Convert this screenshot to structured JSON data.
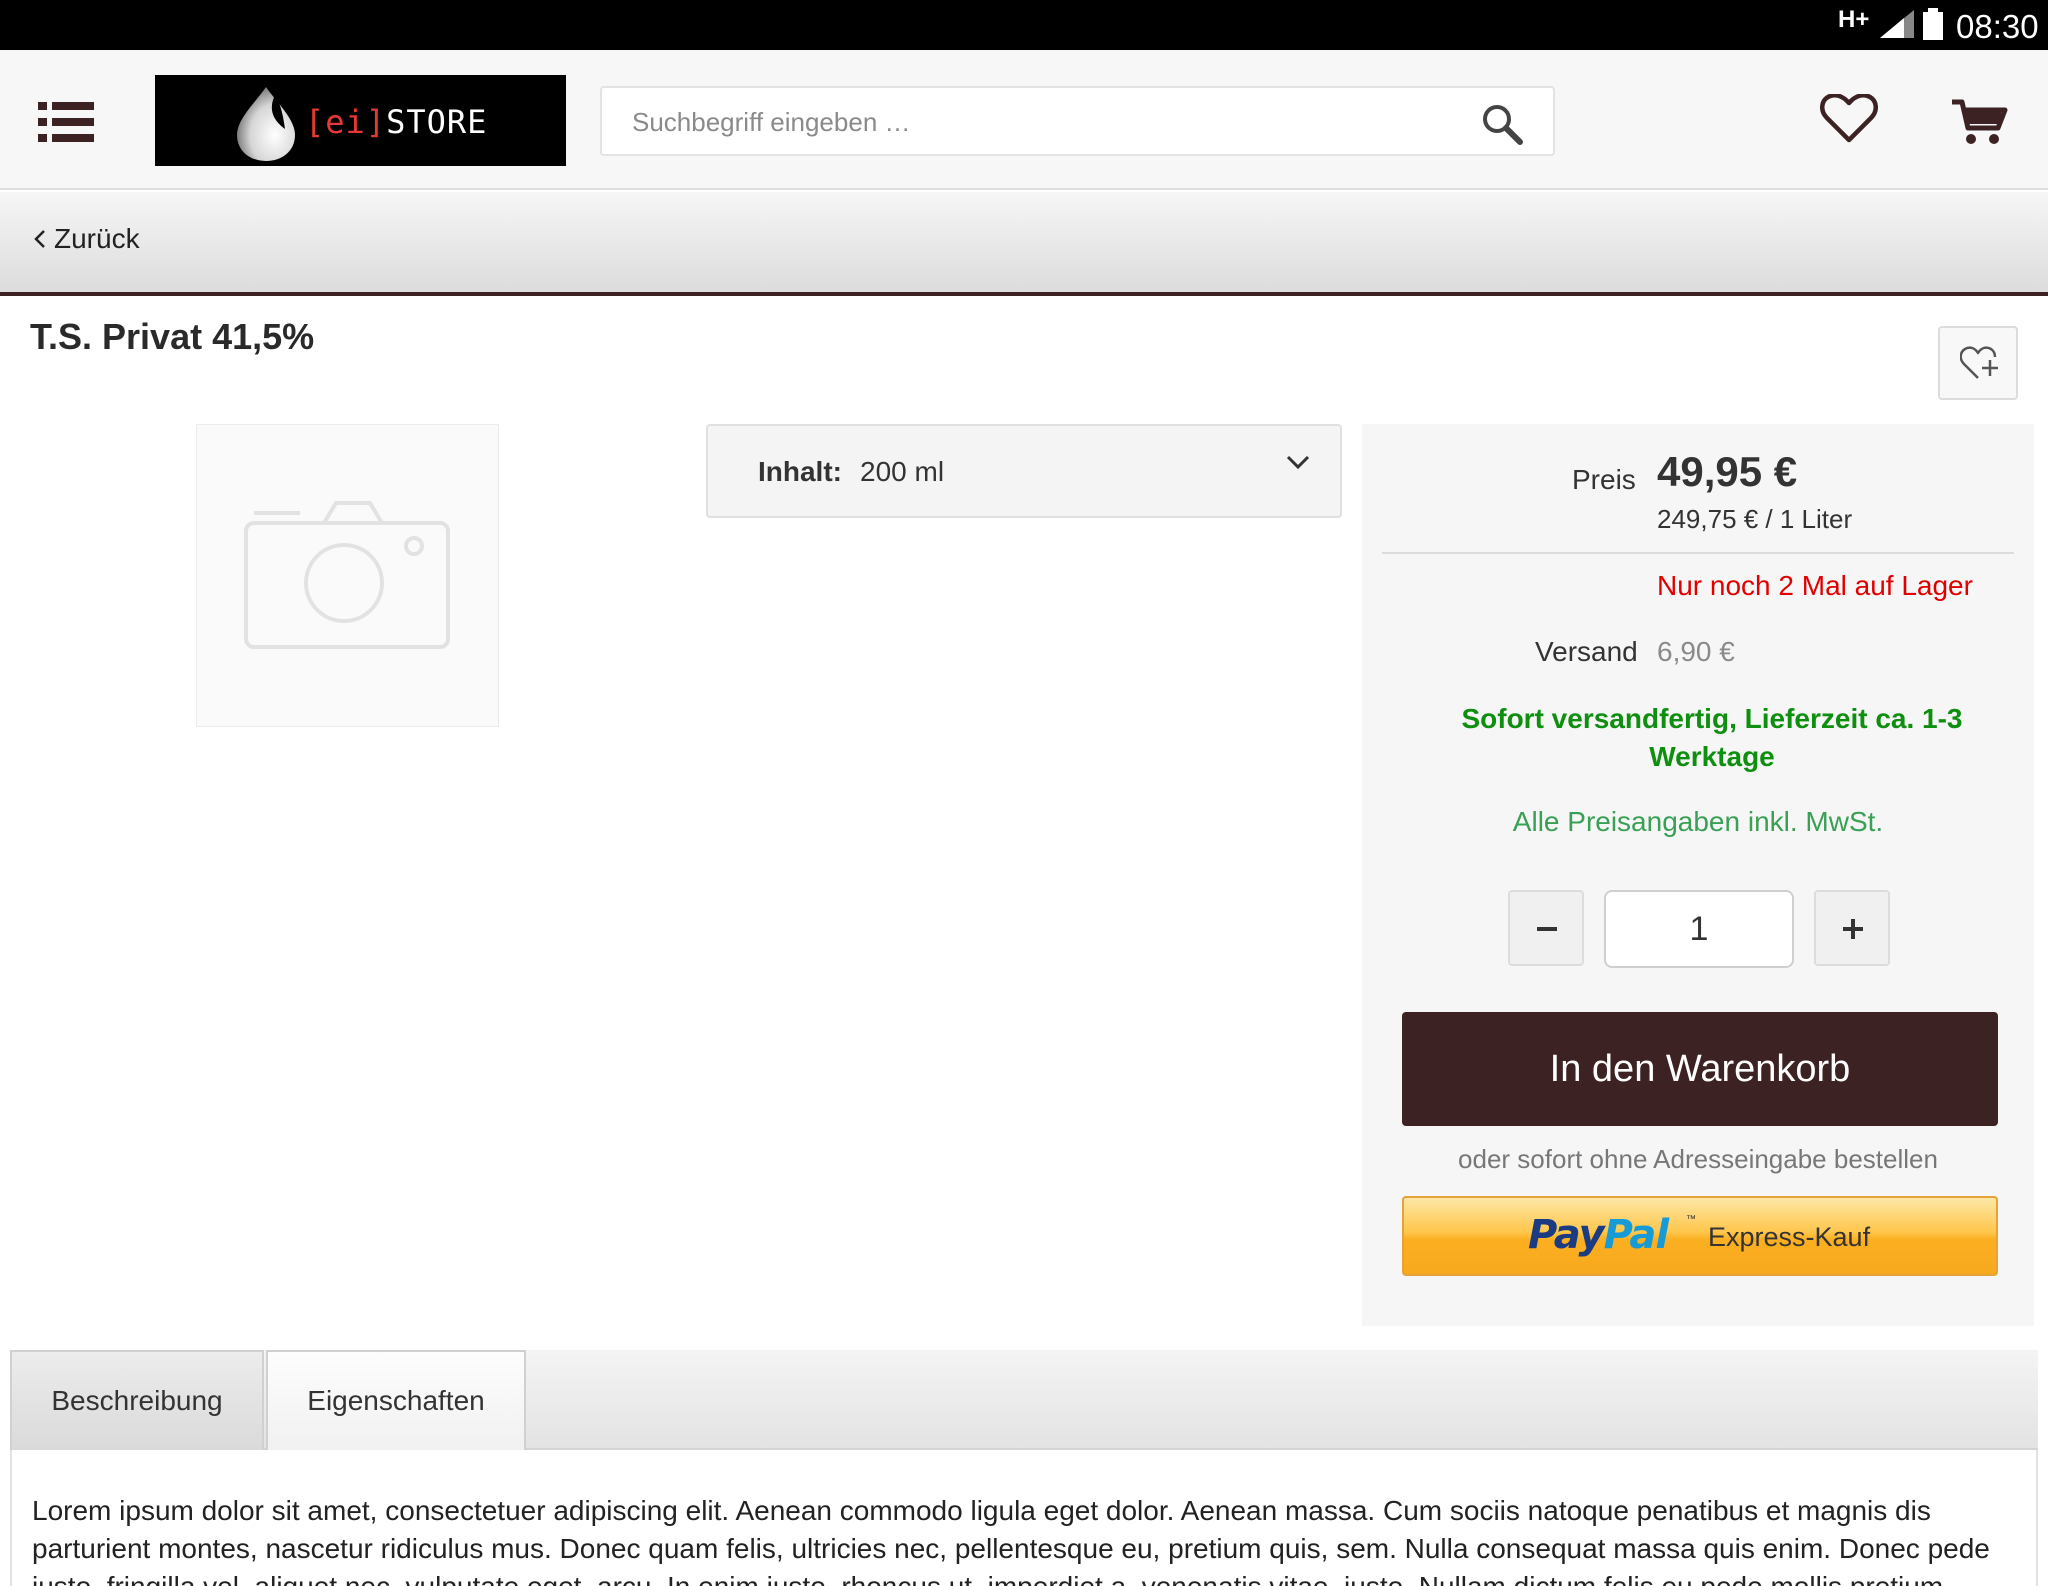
{
  "status_bar": {
    "network": "H+",
    "time": "08:30"
  },
  "header": {
    "logo": {
      "bracket_text": "[ei]",
      "store_text": "STORE"
    },
    "search": {
      "placeholder": "Suchbegriff eingeben …",
      "value": ""
    },
    "icons": [
      "menu-icon",
      "search-icon",
      "heart-icon",
      "cart-icon"
    ]
  },
  "nav": {
    "back_label": "Zurück"
  },
  "product": {
    "title": "T.S. Privat 41,5%",
    "variant": {
      "label": "Inhalt:",
      "value": "200 ml"
    }
  },
  "buybox": {
    "price_label": "Preis",
    "price": "49,95 €",
    "unit_price": "249,75 € / 1 Liter",
    "stock": "Nur noch 2 Mal auf Lager",
    "shipping_label": "Versand",
    "shipping_value": "6,90 €",
    "delivery": "Sofort versandfertig, Lieferzeit ca. 1-3 Werktage",
    "tax_note": "Alle Preisangaben inkl. MwSt.",
    "quantity": "1",
    "add_to_cart": "In den Warenkorb",
    "or_note": "oder sofort ohne Adresseingabe bestellen",
    "paypal": {
      "pay": "Pay",
      "pal": "Pal",
      "tm": "™",
      "express": "Express-Kauf"
    }
  },
  "tabs": [
    {
      "label": "Beschreibung",
      "active": true
    },
    {
      "label": "Eigenschaften",
      "active": false
    }
  ],
  "description": "Lorem ipsum dolor sit amet, consectetuer adipiscing elit. Aenean commodo ligula eget dolor. Aenean massa. Cum sociis natoque penatibus et magnis dis parturient montes, nascetur ridiculus mus. Donec quam felis, ultricies nec, pellentesque eu, pretium quis, sem. Nulla consequat massa quis enim. Donec pede justo, fringilla vel, aliquet nec, vulputate eget, arcu. In enim justo, rhoncus ut, imperdiet a, venenatis vitae, justo. Nullam dictum felis eu pede mollis pretium.",
  "colors": {
    "brand_dark": "#3d2224",
    "stock_red": "#e00000",
    "delivery_green": "#0f8f0f",
    "tax_green": "#3aa055"
  }
}
